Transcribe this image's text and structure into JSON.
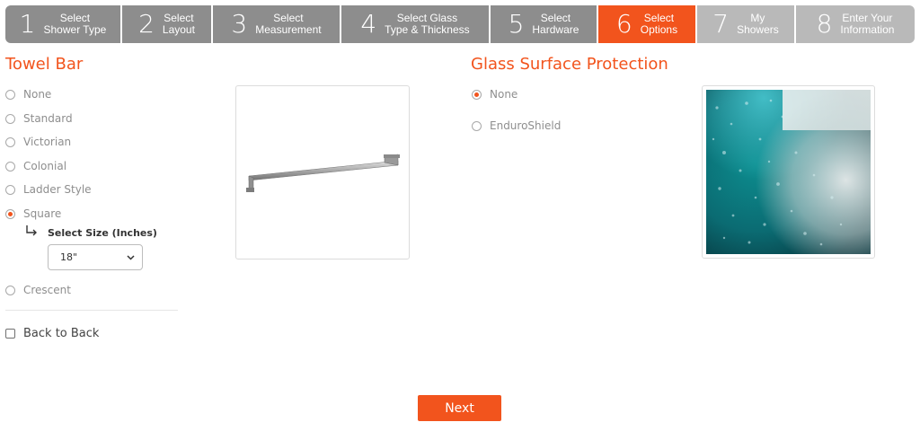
{
  "steps": [
    {
      "num": "1",
      "label": "Select\nShower Type",
      "state": "done"
    },
    {
      "num": "2",
      "label": "Select\nLayout",
      "state": "done"
    },
    {
      "num": "3",
      "label": "Select\nMeasurement",
      "state": "done"
    },
    {
      "num": "4",
      "label": "Select Glass\nType & Thickness",
      "state": "done"
    },
    {
      "num": "5",
      "label": "Select\nHardware",
      "state": "done"
    },
    {
      "num": "6",
      "label": "Select\nOptions",
      "state": "active"
    },
    {
      "num": "7",
      "label": "My\nShowers",
      "state": "upcoming"
    },
    {
      "num": "8",
      "label": "Enter Your\nInformation",
      "state": "upcoming"
    }
  ],
  "towel_bar": {
    "title": "Towel Bar",
    "options": [
      {
        "label": "None",
        "checked": false
      },
      {
        "label": "Standard",
        "checked": false
      },
      {
        "label": "Victorian",
        "checked": false
      },
      {
        "label": "Colonial",
        "checked": false
      },
      {
        "label": "Ladder Style",
        "checked": false
      },
      {
        "label": "Square",
        "checked": true
      },
      {
        "label": "Crescent",
        "checked": false
      }
    ],
    "size_label": "Select Size (Inches)",
    "size_value": "18\"",
    "back_to_back_label": "Back to Back",
    "back_to_back_checked": false
  },
  "glass_protection": {
    "title": "Glass Surface Protection",
    "options": [
      {
        "label": "None",
        "checked": true
      },
      {
        "label": "EnduroShield",
        "checked": false
      }
    ]
  },
  "next_label": "Next",
  "colors": {
    "accent": "#f2541d",
    "step_done": "#8d8d8d",
    "step_upcoming": "#b9b9b9"
  }
}
